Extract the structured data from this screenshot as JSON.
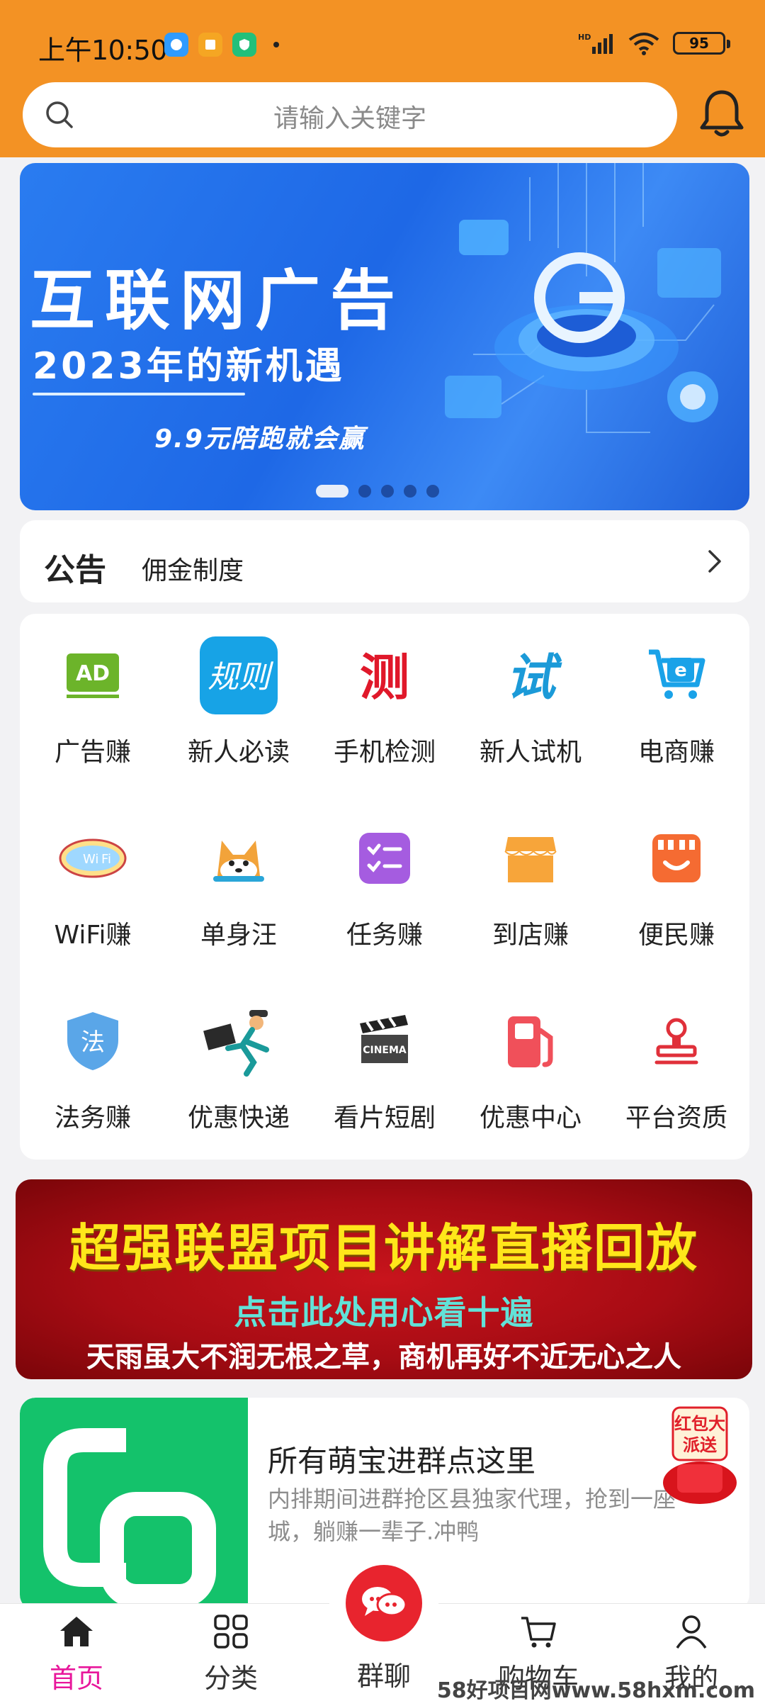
{
  "status_bar": {
    "time": "上午10:50",
    "battery": "95"
  },
  "search": {
    "placeholder": "请输入关键字"
  },
  "banner": {
    "title": "互联网广告",
    "subtitle": "2023年的新机遇",
    "tagline": "9.9元陪跑就会赢",
    "page_count": 5,
    "active_page": 1
  },
  "notice": {
    "label": "公告",
    "text": "佣金制度"
  },
  "grid": [
    {
      "label": "广告赚",
      "icon": "ad-icon"
    },
    {
      "label": "新人必读",
      "icon": "rules-icon"
    },
    {
      "label": "手机检测",
      "icon": "test-icon"
    },
    {
      "label": "新人试机",
      "icon": "trial-icon"
    },
    {
      "label": "电商赚",
      "icon": "cart-e-icon"
    },
    {
      "label": "WiFi赚",
      "icon": "wifi-icon"
    },
    {
      "label": "单身汪",
      "icon": "dog-icon"
    },
    {
      "label": "任务赚",
      "icon": "task-list-icon"
    },
    {
      "label": "到店赚",
      "icon": "store-icon"
    },
    {
      "label": "便民赚",
      "icon": "shop-smile-icon"
    },
    {
      "label": "法务赚",
      "icon": "law-shield-icon"
    },
    {
      "label": "优惠快递",
      "icon": "courier-icon"
    },
    {
      "label": "看片短剧",
      "icon": "clapper-icon"
    },
    {
      "label": "优惠中心",
      "icon": "fuel-icon"
    },
    {
      "label": "平台资质",
      "icon": "stamp-icon"
    }
  ],
  "live_banner": {
    "title": "超强联盟项目讲解直播回放",
    "middle": "点击此处用心看十遍",
    "bottom": "天雨虽大不润无根之草，商机再好不近无心之人"
  },
  "promo": {
    "title": "所有萌宝进群点这里",
    "description": "内排期间进群抢区县独家代理，抢到一座城，躺赚一辈子.冲鸭",
    "badge": "红包大派送"
  },
  "nav": {
    "home": "首页",
    "category": "分类",
    "chat": "群聊",
    "cart": "购物车",
    "mine": "我的",
    "active": "home"
  },
  "watermark": "58好项目网www.58hxm.com",
  "colors": {
    "header": "#f39224",
    "accent_active": "#e8179b",
    "chat_button": "#e8242e"
  }
}
